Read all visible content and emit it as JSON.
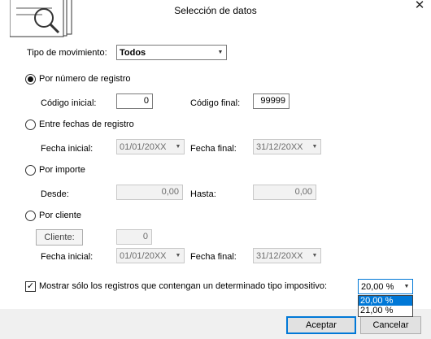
{
  "window": {
    "title": "Selección de datos",
    "close_glyph": "✕"
  },
  "icons": {
    "logo": "documents-search-icon",
    "close": "close-icon"
  },
  "movement": {
    "label": "Tipo de movimiento:",
    "value": "Todos"
  },
  "by_number": {
    "label": "Por número de registro",
    "selected": true,
    "code_start_label": "Código inicial:",
    "code_start_value": "0",
    "code_end_label": "Código final:",
    "code_end_value": "99999"
  },
  "by_dates": {
    "label": "Entre fechas de registro",
    "selected": false,
    "start_label": "Fecha inicial:",
    "start_value": "01/01/20XX",
    "end_label": "Fecha final:",
    "end_value": "31/12/20XX"
  },
  "by_amount": {
    "label": "Por importe",
    "selected": false,
    "from_label": "Desde:",
    "from_value": "0,00",
    "to_label": "Hasta:",
    "to_value": "0,00"
  },
  "by_client": {
    "label": "Por cliente",
    "selected": false,
    "client_button": "Cliente:",
    "client_value": "0",
    "start_label": "Fecha inicial:",
    "start_value": "01/01/20XX",
    "end_label": "Fecha final:",
    "end_value": "31/12/20XX"
  },
  "tax_filter": {
    "checked": true,
    "check_glyph": "✓",
    "label": "Mostrar sólo los registros que contengan un determinado tipo impositivo:",
    "value": "20,00 %",
    "options": [
      "20,00 %",
      "21,00 %"
    ],
    "highlighted_option": "20,00 %"
  },
  "buttons": {
    "accept": "Aceptar",
    "cancel": "Cancelar"
  },
  "colors": {
    "accent": "#0078d7",
    "disabled_bg": "#f2f2f2",
    "footer_bg": "#f0f0f0"
  }
}
